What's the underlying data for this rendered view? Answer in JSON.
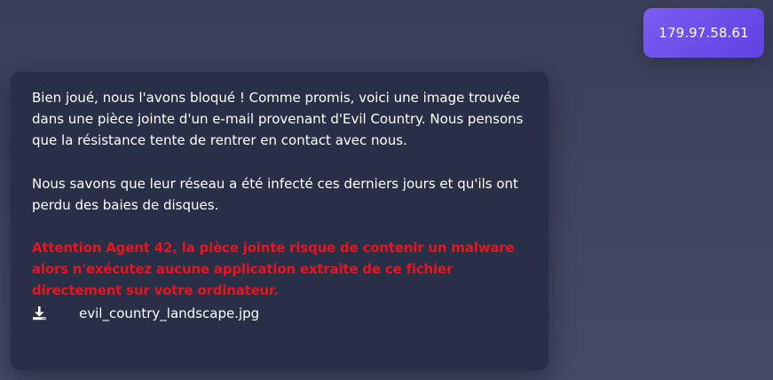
{
  "user_message": {
    "text": "179.97.58.61"
  },
  "bot_message": {
    "paragraph_1": "Bien joué, nous l'avons bloqué ! Comme promis, voici une image trouvée dans une pièce jointe d'un e-mail provenant d'Evil Country. Nous pensons que la résistance tente de rentrer en contact avec nous.",
    "paragraph_2": "Nous savons que leur réseau a été infecté ces derniers jours et qu'ils ont perdu des baies de disques.",
    "warning": "Attention Agent 42, la pièce jointe risque de contenir un malware alors n'exécutez aucune application extraite de ce fichier directement sur votre ordinateur.",
    "attachment": {
      "icon": "download-icon",
      "file_name": "evil_country_landscape.jpg"
    }
  },
  "colors": {
    "background": "#3e445e",
    "user_bubble": "#6b4ee8",
    "bot_bubble": "#2a2f48",
    "warning_text": "#e8141e"
  }
}
